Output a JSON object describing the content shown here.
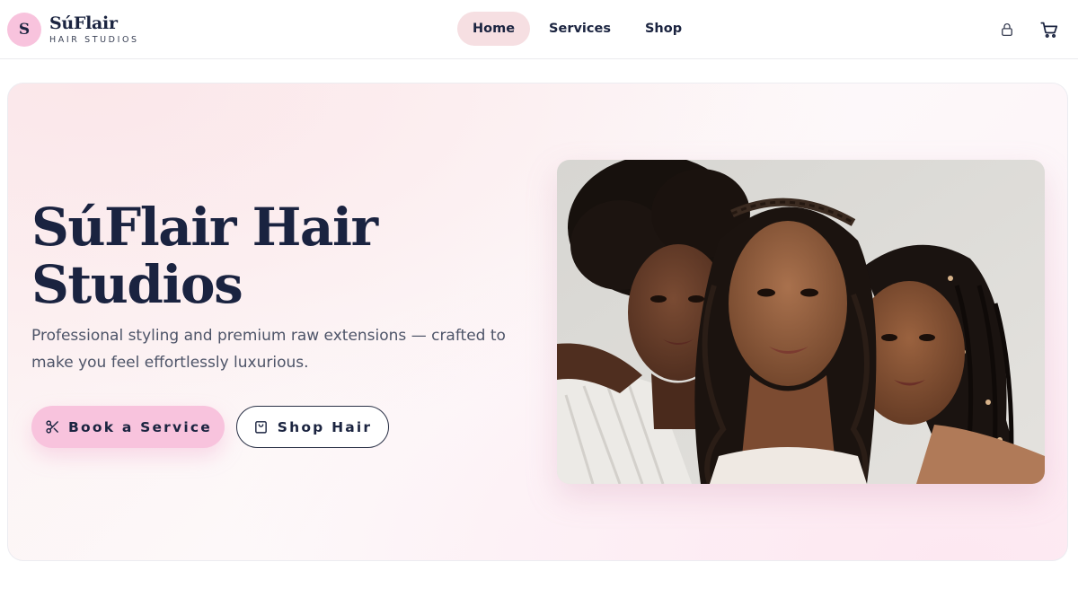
{
  "brand": {
    "badge_letter": "S",
    "name": "SúFlair",
    "subtitle": "HAIR STUDIOS"
  },
  "nav": {
    "items": [
      {
        "label": "Home",
        "active": true
      },
      {
        "label": "Services",
        "active": false
      },
      {
        "label": "Shop",
        "active": false
      }
    ]
  },
  "header_icons": {
    "account": "lock-icon",
    "cart": "cart-icon"
  },
  "hero": {
    "title_line1": "SúFlair Hair",
    "title_line2": "Studios",
    "description": "Professional styling and premium raw extensions — crafted to make you feel effortlessly luxurious.",
    "primary_button": {
      "label": "Book a Service",
      "icon": "scissors-icon"
    },
    "secondary_button": {
      "label": "Shop Hair",
      "icon": "shopping-bag-icon"
    },
    "photo": {
      "subject": "three women with natural hair, braids and wavy extensions"
    }
  },
  "colors": {
    "accent_pink": "#f8c3dd",
    "nav_active_bg": "#f6dfe2",
    "navy_text": "#1b2440",
    "body_text": "#4d5468"
  }
}
